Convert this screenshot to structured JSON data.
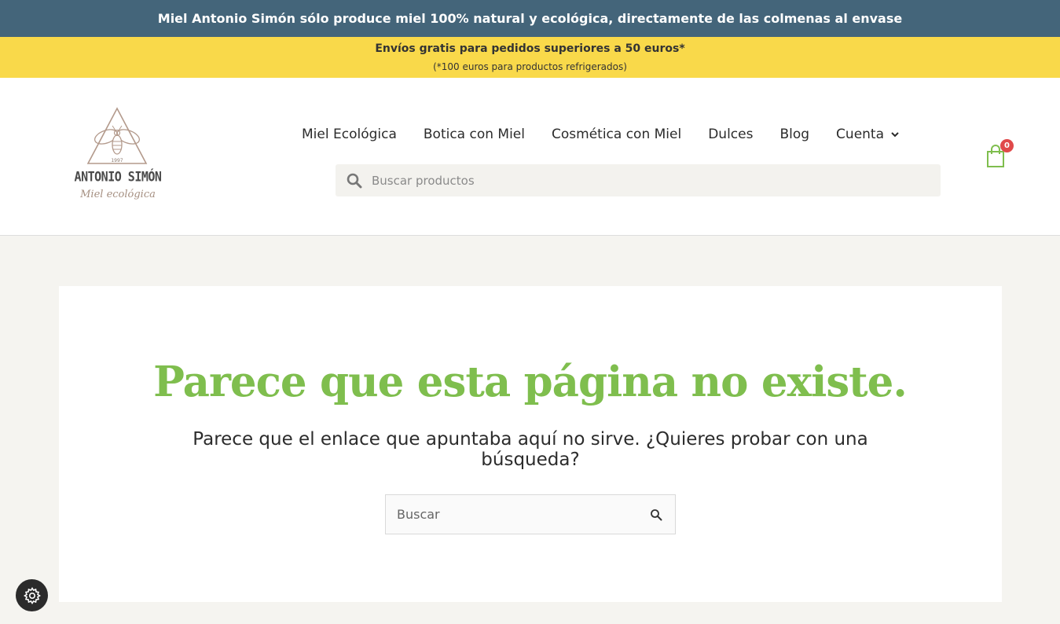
{
  "banner": {
    "text": "Miel Antonio Simón sólo produce miel 100% natural y ecológica, directamente de las colmenas al envase",
    "background": "#44657a"
  },
  "promo": {
    "main": "Envíos gratis para pedidos superiores a 50 euros*",
    "sub": "(*100 euros para productos refrigerados)",
    "background": "#f9d94a"
  },
  "logo": {
    "name": "ANTONIO SIMÓN",
    "tagline": "Miel ecológica",
    "year": "1997"
  },
  "nav": {
    "items": [
      {
        "label": "Miel Ecológica"
      },
      {
        "label": "Botica con Miel"
      },
      {
        "label": "Cosmética con Miel"
      },
      {
        "label": "Dulces"
      },
      {
        "label": "Blog"
      },
      {
        "label": "Cuenta",
        "icon": "chevron-down-icon"
      }
    ]
  },
  "header_search": {
    "placeholder": "Buscar productos",
    "icon": "search-icon"
  },
  "cart": {
    "count": "0",
    "icon": "shopping-bag-icon",
    "color": "#7fbe4e",
    "badge_color": "#e0494a"
  },
  "main": {
    "title": "Parece que esta página no existe.",
    "subtitle": "Parece que el enlace que apuntaba aquí no sirve. ¿Quieres probar con una búsqueda?",
    "title_color": "#7fbe4e",
    "search": {
      "placeholder": "Buscar",
      "icon": "search-icon"
    }
  },
  "settings": {
    "icon": "gear-icon"
  }
}
